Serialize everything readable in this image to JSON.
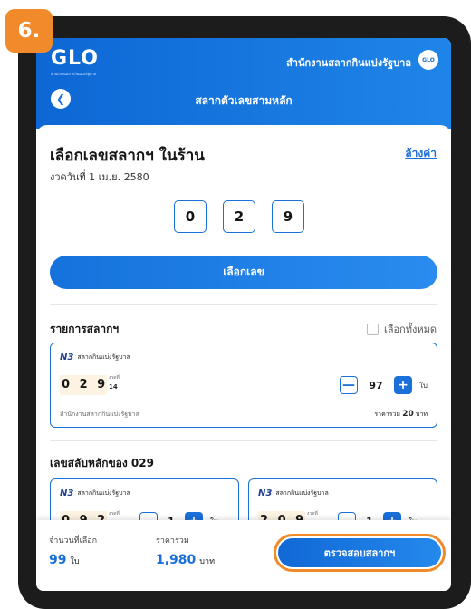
{
  "step_badge": "6.",
  "header": {
    "logo": "GLO",
    "logo_sub": "สำนักงานสลากกินแบ่งรัฐบาล",
    "org_title": "สำนักงานสลากกินแบ่งรัฐบาล",
    "org_badge": "GLO",
    "page_title": "สลากตัวเลขสามหลัก"
  },
  "selector": {
    "title": "เลือกเลขสลากฯ ในร้าน",
    "clear_label": "ล้างค่า",
    "draw_date": "งวดวันที่ 1 เม.ย. 2580",
    "digits": [
      "0",
      "2",
      "9"
    ],
    "select_button": "เลือกเลข"
  },
  "list": {
    "title": "รายการสลากฯ",
    "select_all": "เลือกทั้งหมด",
    "ticket": {
      "brand_mark": "N3",
      "brand": "สลากกินแบ่งรัฐบาล",
      "number": "0 2 9",
      "draw_label": "งวดที่",
      "draw_no": "14",
      "qty": "97",
      "unit": "ใบ",
      "org": "สำนักงานสลากกินแบ่งรัฐบาล",
      "total_prefix": "ราคารวม",
      "total_value": "20",
      "total_suffix": "บาท"
    }
  },
  "permutations": {
    "title": "เลขสลับหลักของ 029",
    "cards": [
      {
        "brand_mark": "N3",
        "brand": "สลากกินแบ่งรัฐบาล",
        "number": "0 9 2",
        "draw_label": "งวดที่",
        "qty": "1",
        "unit": "ใบ"
      },
      {
        "brand_mark": "N3",
        "brand": "สลากกินแบ่งรัฐบาล",
        "number": "2 0 9",
        "draw_label": "งวดที่",
        "qty": "1",
        "unit": "ใบ"
      }
    ]
  },
  "bottom": {
    "qty_label": "จำนวนที่เลือก",
    "qty_value": "99",
    "qty_unit": "ใบ",
    "price_label": "ราคารวม",
    "price_value": "1,980",
    "price_unit": "บาท",
    "check_button": "ตรวจสอบสลากฯ"
  },
  "colors": {
    "primary": "#1b6fd9",
    "highlight": "#f08a2a"
  }
}
